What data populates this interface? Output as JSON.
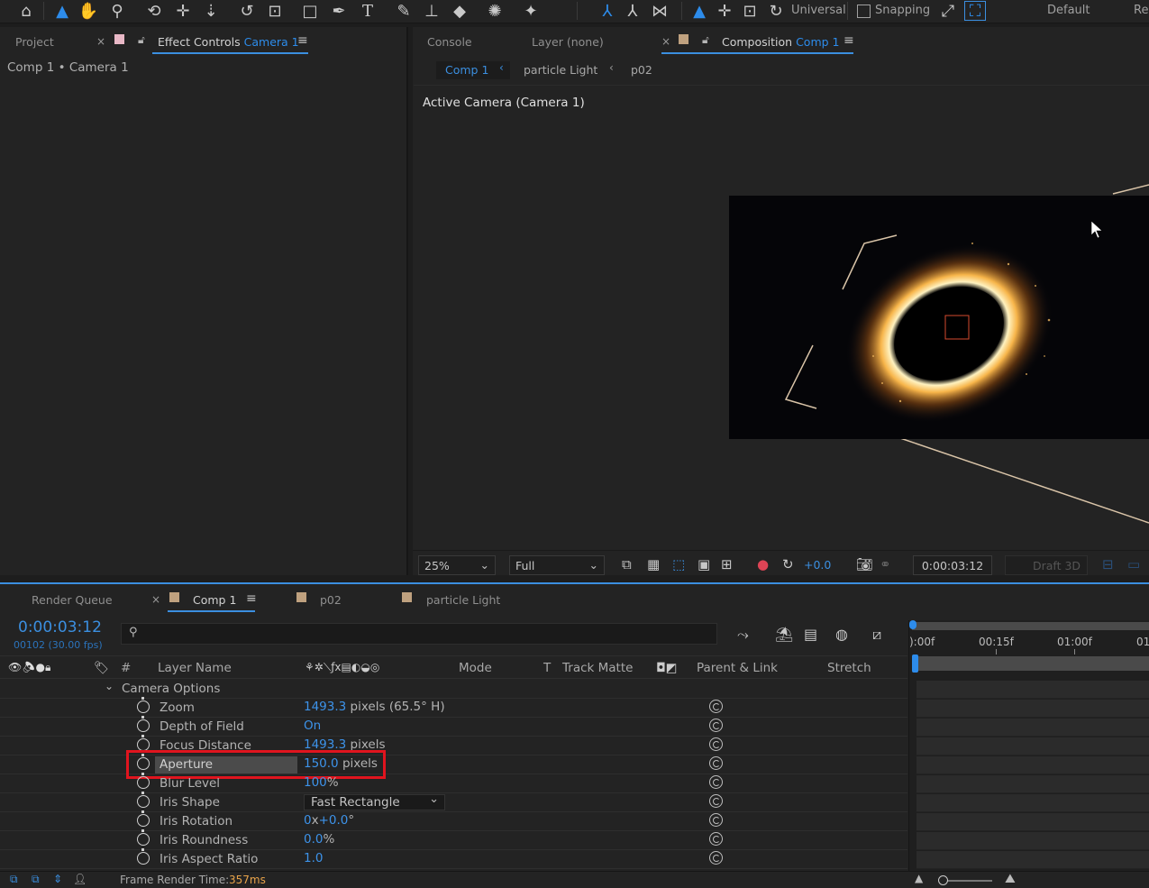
{
  "toolbar": {
    "universal_label": "Universal",
    "snapping_label": "Snapping",
    "workspace_default": "Default",
    "workspace_review": "Re",
    "icons": [
      "home-icon",
      "selection-arrow-icon",
      "hand-icon",
      "zoom-icon",
      "orbit-camera-icon",
      "pan-camera-icon",
      "dolly-camera-icon",
      "rotate-icon",
      "pan-behind-icon",
      "rectangle-icon",
      "pen-icon",
      "type-icon",
      "brush-icon",
      "clone-stamp-icon",
      "eraser-icon",
      "roto-brush-icon",
      "puppet-pin-icon",
      "local-axis-icon",
      "world-axis-icon",
      "view-axis-icon",
      "selection-tool-icon",
      "move-icon",
      "scale-icon",
      "rotate-gizmo-icon"
    ]
  },
  "left_panel": {
    "tab_project": "Project",
    "tab_effect_controls": "Effect Controls",
    "tab_effect_controls_target": "Camera 1",
    "breadcrumb": "Comp 1 • Camera 1",
    "swatch_color": "#e8b8c6"
  },
  "right_panel": {
    "tab_console": "Console",
    "tab_layer": "Layer (none)",
    "tab_composition": "Composition",
    "tab_composition_target": "Comp 1",
    "subtabs": [
      "Comp 1",
      "particle Light",
      "p02"
    ],
    "viewer_label": "Active Camera (Camera 1)",
    "swatch_color": "#bfa17f",
    "zoom": "25%",
    "resolution": "Full",
    "exposure": "+0.0",
    "timecode": "0:00:03:12",
    "draft3d": "Draft 3D"
  },
  "timeline": {
    "tab_render_queue": "Render Queue",
    "tab_comp": "Comp 1",
    "tab_p02": "p02",
    "tab_particle": "particle Light",
    "current_time": "0:00:03:12",
    "frame_info": "00102 (30.00 fps)",
    "columns": {
      "hash": "#",
      "layer_name": "Layer Name",
      "mode": "Mode",
      "t": "T",
      "track_matte": "Track Matte",
      "parent_link": "Parent & Link",
      "stretch": "Stretch"
    },
    "ruler": [
      "):00f",
      "00:15f",
      "01:00f",
      "01"
    ],
    "group_label": "Camera Options",
    "properties": [
      {
        "name": "Zoom",
        "value": "1493.3",
        "unit": " pixels (65.5° H)"
      },
      {
        "name": "Depth of Field",
        "value": "On",
        "unit": ""
      },
      {
        "name": "Focus Distance",
        "value": "1493.3",
        "unit": " pixels"
      },
      {
        "name": "Aperture",
        "value": "150.0",
        "unit": " pixels"
      },
      {
        "name": "Blur Level",
        "value": "100",
        "unit": "%"
      },
      {
        "name": "Iris Shape",
        "value": "Fast Rectangle",
        "unit": ""
      },
      {
        "name": "Iris Rotation",
        "value": "0",
        "unit": "x",
        "value2": "+0.0",
        "unit2": "°"
      },
      {
        "name": "Iris Roundness",
        "value": "0.0",
        "unit": "%"
      },
      {
        "name": "Iris Aspect Ratio",
        "value": "1.0",
        "unit": ""
      }
    ],
    "highlight_color": "#e0141e"
  },
  "status": {
    "frame_render_label": "Frame Render Time:",
    "frame_render_value": "357ms"
  },
  "colors": {
    "accent_blue": "#2d8ceb",
    "value_blue": "#3d93ea",
    "render_orange": "#e8a34a"
  }
}
